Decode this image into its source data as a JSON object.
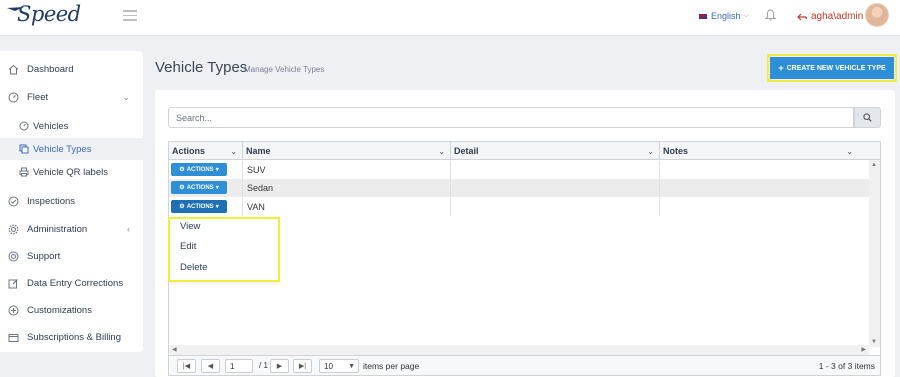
{
  "header": {
    "logo_text": "Speed",
    "language": "English",
    "user": "agha\\admin"
  },
  "sidebar": {
    "items": [
      {
        "label": "Dashboard",
        "icon": "home-icon"
      },
      {
        "label": "Fleet",
        "icon": "gauge-icon"
      },
      {
        "label": "Vehicles",
        "icon": "speedometer-icon"
      },
      {
        "label": "Vehicle Types",
        "icon": "copy-icon"
      },
      {
        "label": "Vehicle QR labels",
        "icon": "printer-icon"
      },
      {
        "label": "Inspections",
        "icon": "check-circle-icon"
      },
      {
        "label": "Administration",
        "icon": "gear-icon"
      },
      {
        "label": "Support",
        "icon": "support-icon"
      },
      {
        "label": "Data Entry Corrections",
        "icon": "edit-icon"
      },
      {
        "label": "Customizations",
        "icon": "plus-circle-icon"
      },
      {
        "label": "Subscriptions & Billing",
        "icon": "wallet-icon"
      }
    ]
  },
  "main": {
    "title": "Vehicle Types",
    "subtitle": "Manage Vehicle Types",
    "create_label": "CREATE NEW VEHICLE TYPE",
    "search_placeholder": "Search..."
  },
  "grid": {
    "columns": [
      "Actions",
      "Name",
      "Detail",
      "Notes"
    ],
    "actions_label": "ACTIONS",
    "rows": [
      {
        "name": "SUV",
        "detail": "",
        "notes": ""
      },
      {
        "name": "Sedan",
        "detail": "",
        "notes": ""
      },
      {
        "name": "VAN",
        "detail": "",
        "notes": ""
      }
    ]
  },
  "menu": {
    "items": [
      "View",
      "Edit",
      "Delete"
    ]
  },
  "pager": {
    "page": "1",
    "total_pages": "1",
    "page_of": "/ 1",
    "page_size": "10",
    "per_page_label": "items per page",
    "info": "1 - 3 of 3 items"
  },
  "colors": {
    "primary": "#2e8ed6",
    "highlight": "#f2ee3a",
    "user": "#c0392b"
  }
}
